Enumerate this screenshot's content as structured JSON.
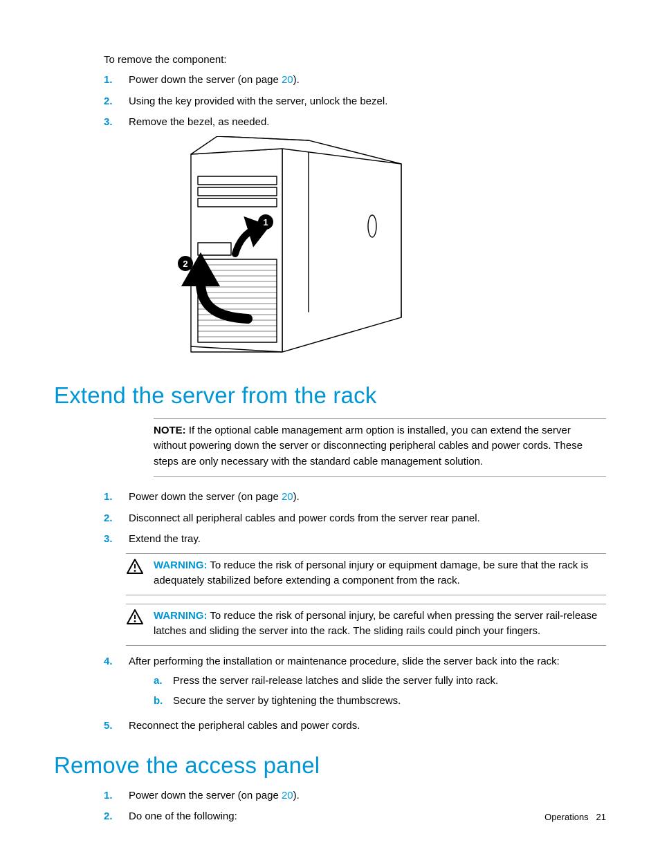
{
  "intro": "To remove the component:",
  "sectionA": {
    "items": [
      {
        "num": "1.",
        "pre": "Power down the server (on page ",
        "link": "20",
        "post": ")."
      },
      {
        "num": "2.",
        "text": "Using the key provided with the server, unlock the bezel."
      },
      {
        "num": "3.",
        "text": "Remove the bezel, as needed."
      }
    ]
  },
  "heading1": "Extend the server from the rack",
  "note": {
    "label": "NOTE:",
    "text": "If the optional cable management arm option is installed, you can extend the server without powering down the server or disconnecting peripheral cables and power cords. These steps are only necessary with the standard cable management solution."
  },
  "sectionB": {
    "items": [
      {
        "num": "1.",
        "pre": "Power down the server (on page ",
        "link": "20",
        "post": ")."
      },
      {
        "num": "2.",
        "text": "Disconnect all peripheral cables and power cords from the server rear panel."
      },
      {
        "num": "3.",
        "text": "Extend the tray."
      }
    ],
    "warnings": [
      {
        "label": "WARNING:",
        "text": "To reduce the risk of personal injury or equipment damage, be sure that the rack is adequately stabilized before extending a component from the rack."
      },
      {
        "label": "WARNING:",
        "text": "To reduce the risk of personal injury, be careful when pressing the server rail-release latches and sliding the server into the rack. The sliding rails could pinch your fingers."
      }
    ],
    "item4": {
      "num": "4.",
      "text": "After performing the installation or maintenance procedure, slide the server back into the rack:",
      "sub": [
        {
          "alpha": "a.",
          "text": "Press the server rail-release latches and slide the server fully into rack."
        },
        {
          "alpha": "b.",
          "text": "Secure the server by tightening the thumbscrews."
        }
      ]
    },
    "item5": {
      "num": "5.",
      "text": "Reconnect the peripheral cables and power cords."
    }
  },
  "heading2": "Remove the access panel",
  "sectionC": {
    "items": [
      {
        "num": "1.",
        "pre": "Power down the server (on page ",
        "link": "20",
        "post": ")."
      },
      {
        "num": "2.",
        "text": "Do one of the following:"
      }
    ]
  },
  "footer": {
    "section": "Operations",
    "page": "21"
  }
}
